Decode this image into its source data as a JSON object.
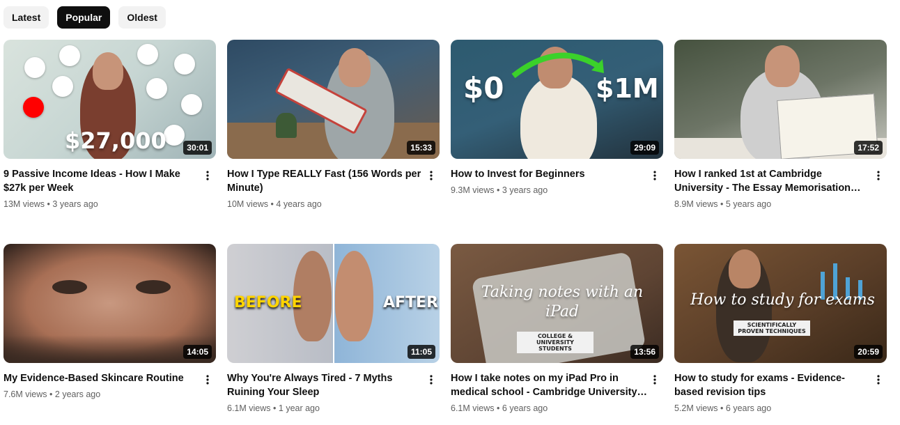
{
  "filters": [
    {
      "label": "Latest",
      "active": false
    },
    {
      "label": "Popular",
      "active": true
    },
    {
      "label": "Oldest",
      "active": false
    }
  ],
  "videos": [
    {
      "title": "9 Passive Income Ideas - How I Make $27k per Week",
      "views": "13M views",
      "age": "3 years ago",
      "duration": "30:01",
      "thumb_text": "$27,000"
    },
    {
      "title": "How I Type REALLY Fast (156 Words per Minute)",
      "views": "10M views",
      "age": "4 years ago",
      "duration": "15:33"
    },
    {
      "title": "How to Invest for Beginners",
      "views": "9.3M views",
      "age": "3 years ago",
      "duration": "29:09",
      "thumb_text_left": "$0",
      "thumb_text_right": "$1M"
    },
    {
      "title": "How I ranked 1st at Cambridge University - The Essay Memorisation Framework",
      "views": "8.9M views",
      "age": "5 years ago",
      "duration": "17:52"
    },
    {
      "title": "My Evidence-Based Skincare Routine",
      "views": "7.6M views",
      "age": "2 years ago",
      "duration": "14:05"
    },
    {
      "title": "Why You're Always Tired - 7 Myths Ruining Your Sleep",
      "views": "6.1M views",
      "age": "1 year ago",
      "duration": "11:05",
      "thumb_text_left": "BEFORE",
      "thumb_text_right": "AFTER"
    },
    {
      "title": "How I take notes on my iPad Pro in medical school - Cambridge University medical…",
      "views": "6.1M views",
      "age": "6 years ago",
      "duration": "13:56",
      "thumb_script": "Taking notes with an iPad",
      "thumb_tag": "COLLEGE & UNIVERSITY STUDENTS"
    },
    {
      "title": "How to study for exams - Evidence-based revision tips",
      "views": "5.2M views",
      "age": "6 years ago",
      "duration": "20:59",
      "thumb_script": "How to study for exams",
      "thumb_tag": "SCIENTIFICALLY PROVEN TECHNIQUES"
    }
  ],
  "separator": "•",
  "colors": {
    "chip_active_bg": "#0f0f0f",
    "chip_bg": "#f2f2f2",
    "meta_text": "#606060",
    "accent_green": "#3bd12a",
    "accent_yellow": "#ffd400"
  },
  "icons": {
    "more": "vertical-dots-icon"
  }
}
